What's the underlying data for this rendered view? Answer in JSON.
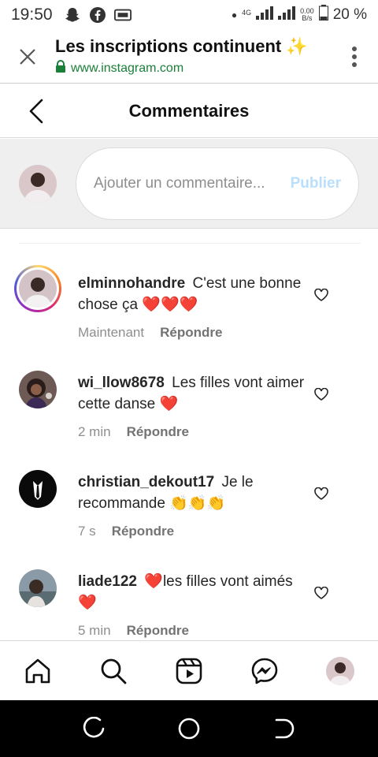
{
  "status_bar": {
    "time": "19:50",
    "network": "4G",
    "speed_top": "0.00",
    "speed_unit": "B/s",
    "battery": "20 %"
  },
  "browser": {
    "page_title": "Les inscriptions continuent ✨",
    "url": "www.instagram.com"
  },
  "header": {
    "title": "Commentaires"
  },
  "composer": {
    "placeholder": "Ajouter un commentaire...",
    "post_label": "Publier"
  },
  "comments": [
    {
      "username": "elminnohandre",
      "text": "C'est une bonne chose ça ❤️❤️❤️",
      "time": "Maintenant",
      "reply_label": "Répondre",
      "avatar_icon": "profile-photo",
      "has_story_ring": true
    },
    {
      "username": "wi_llow8678",
      "text": "Les filles vont aimer cette danse ❤️",
      "time": "2 min",
      "reply_label": "Répondre",
      "avatar_icon": "profile-photo"
    },
    {
      "username": "christian_dekout17",
      "text": "Je le recommande 👏👏👏",
      "time": "7 s",
      "reply_label": "Répondre",
      "avatar_icon": "tuxedo-logo"
    },
    {
      "username": "liade122",
      "text": "❤️les filles vont aimés❤️",
      "time": "5 min",
      "reply_label": "Répondre",
      "avatar_icon": "profile-photo"
    }
  ],
  "bottom_nav": [
    "home-icon",
    "search-icon",
    "reels-icon",
    "messenger-icon",
    "profile-avatar"
  ],
  "colors": {
    "post_disabled": "#b9dffc",
    "heart_red": "#ed4956",
    "secure_green": "#1a7f37"
  }
}
